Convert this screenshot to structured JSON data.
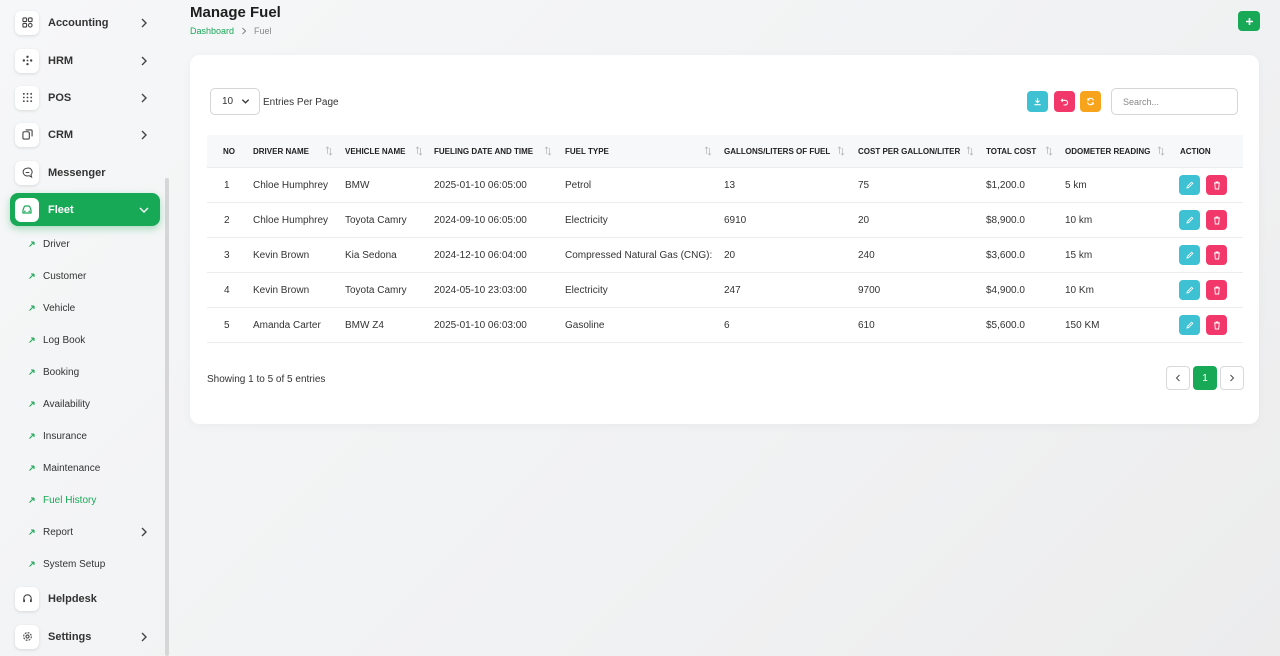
{
  "sidebar": {
    "items": [
      {
        "label": "Accounting",
        "icon": "grid-icon"
      },
      {
        "label": "HRM",
        "icon": "org-icon"
      },
      {
        "label": "POS",
        "icon": "dots-grid-icon"
      },
      {
        "label": "CRM",
        "icon": "layers-icon"
      },
      {
        "label": "Messenger",
        "icon": "chat-icon"
      },
      {
        "label": "Fleet",
        "icon": "car-icon"
      },
      {
        "label": "Helpdesk",
        "icon": "headset-icon"
      },
      {
        "label": "Settings",
        "icon": "gear-icon"
      }
    ],
    "fleet_sub": [
      {
        "label": "Driver"
      },
      {
        "label": "Customer"
      },
      {
        "label": "Vehicle"
      },
      {
        "label": "Log Book"
      },
      {
        "label": "Booking"
      },
      {
        "label": "Availability"
      },
      {
        "label": "Insurance"
      },
      {
        "label": "Maintenance"
      },
      {
        "label": "Fuel History"
      },
      {
        "label": "Report"
      },
      {
        "label": "System Setup"
      }
    ]
  },
  "header": {
    "title": "Manage Fuel",
    "breadcrumb_home": "Dashboard",
    "breadcrumb_current": "Fuel"
  },
  "toolbar": {
    "per_page_value": "10",
    "per_page_label": "Entries Per Page",
    "search_placeholder": "Search..."
  },
  "table": {
    "columns": [
      "NO",
      "DRIVER NAME",
      "VEHICLE NAME",
      "FUELING DATE AND TIME",
      "FUEL TYPE",
      "GALLONS/LITERS OF FUEL",
      "COST PER GALLON/LITER",
      "TOTAL COST",
      "ODOMETER READING",
      "ACTION"
    ],
    "rows": [
      [
        "1",
        "Chloe Humphrey",
        "BMW",
        "2025-01-10 06:05:00",
        "Petrol",
        "13",
        "75",
        "$1,200.0",
        "5 km"
      ],
      [
        "2",
        "Chloe Humphrey",
        "Toyota Camry",
        "2024-09-10 06:05:00",
        "Electricity",
        "6910",
        "20",
        "$8,900.0",
        "10 km"
      ],
      [
        "3",
        "Kevin Brown",
        "Kia Sedona",
        "2024-12-10 06:04:00",
        "Compressed Natural Gas (CNG):",
        "20",
        "240",
        "$3,600.0",
        "15 km"
      ],
      [
        "4",
        "Kevin Brown",
        "Toyota Camry",
        "2024-05-10 23:03:00",
        "Electricity",
        "247",
        "9700",
        "$4,900.0",
        "10 Km"
      ],
      [
        "5",
        "Amanda Carter",
        "BMW Z4",
        "2025-01-10 06:03:00",
        "Gasoline",
        "6",
        "610",
        "$5,600.0",
        "150 KM"
      ]
    ]
  },
  "footer": {
    "showing": "Showing 1 to 5 of 5 entries",
    "current_page": "1"
  },
  "colors": {
    "brand": "#18a957",
    "edit": "#3ec1d3",
    "delete": "#f2386a",
    "refresh": "#f7a41c"
  }
}
